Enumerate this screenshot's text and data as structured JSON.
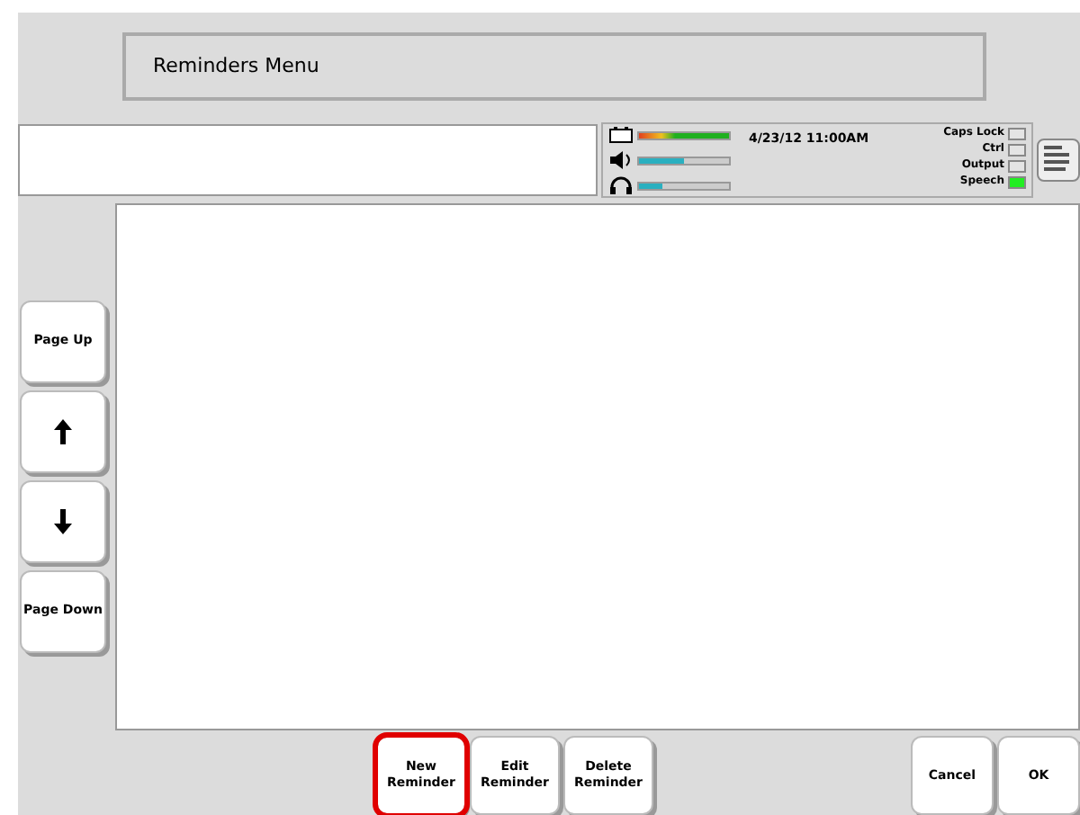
{
  "title": "Reminders Menu",
  "status": {
    "datetime": "4/23/12 11:00AM",
    "meters": [
      {
        "kind": "battery",
        "level": 1.0
      },
      {
        "kind": "volume",
        "level": 0.5
      },
      {
        "kind": "headphones",
        "level": 0.26
      }
    ],
    "indicators": [
      {
        "label": "Caps Lock",
        "on": false
      },
      {
        "label": "Ctrl",
        "on": false
      },
      {
        "label": "Output",
        "on": false
      },
      {
        "label": "Speech",
        "on": true
      }
    ]
  },
  "scroll_buttons": [
    {
      "kind": "text",
      "label": "Page Up"
    },
    {
      "kind": "up"
    },
    {
      "kind": "down"
    },
    {
      "kind": "text",
      "label": "Page Down"
    }
  ],
  "actions": [
    {
      "label": "New Reminder",
      "selected": true
    },
    {
      "label": "Edit Reminder",
      "selected": false
    },
    {
      "label": "Delete Reminder",
      "selected": false
    }
  ],
  "dialog_buttons": [
    "Cancel",
    "OK"
  ]
}
